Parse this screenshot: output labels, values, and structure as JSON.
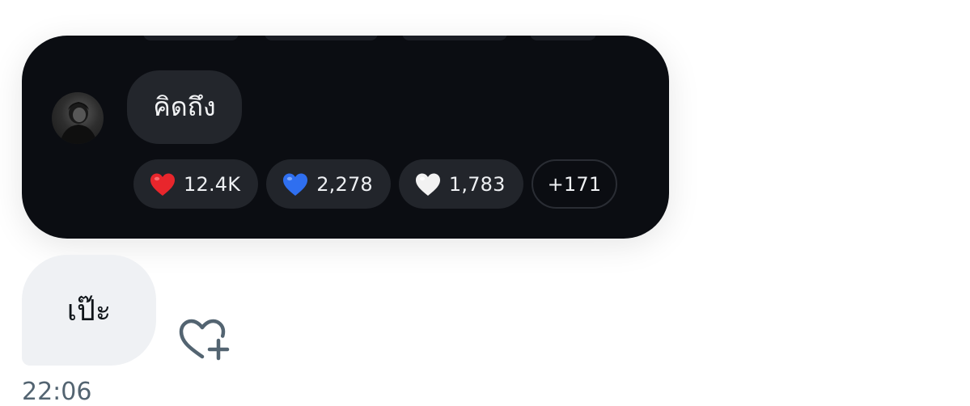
{
  "quoted_message": {
    "text": "คิดถึง",
    "reactions": [
      {
        "emoji": "red-heart",
        "color": "#e8262c",
        "count": "12.4K"
      },
      {
        "emoji": "blue-heart",
        "color": "#2f6ff0",
        "count": "2,278"
      },
      {
        "emoji": "white-heart",
        "color": "#f2f2f2",
        "count": "1,783"
      }
    ],
    "more_reactions": "+171"
  },
  "own_message": {
    "text": "เป๊ะ",
    "timestamp": "22:06"
  },
  "icons": {
    "add_reaction": "heart-plus-icon",
    "avatar": "user-avatar"
  },
  "colors": {
    "dark_card": "#0b0d12",
    "reaction_pill": "#22252b",
    "light_bubble": "#eff1f4",
    "timestamp": "#536471"
  }
}
